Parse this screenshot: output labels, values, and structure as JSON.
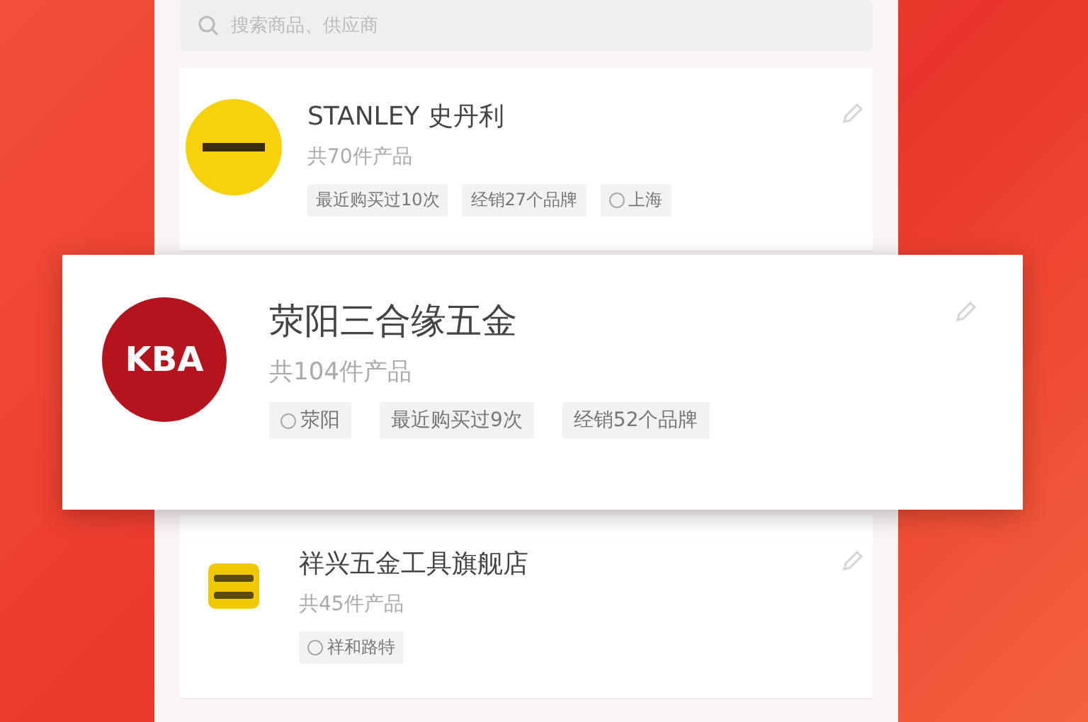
{
  "search": {
    "placeholder": "搜索商品、供应商"
  },
  "stores": [
    {
      "selected": false,
      "name": "STANLEY 史丹利",
      "count": "共70件产品",
      "logo": {
        "kind": "stanley"
      },
      "tags": [
        {
          "text": "最近购买过10次",
          "location": false
        },
        {
          "text": "经销27个品牌",
          "location": false
        },
        {
          "text": "上海",
          "location": true
        }
      ]
    },
    {
      "selected": true,
      "name": "荥阳三合缘五金",
      "count": "共104件产品",
      "logo": {
        "kind": "letters",
        "text": "KBA"
      },
      "tags": [
        {
          "text": "荥阳",
          "location": true
        },
        {
          "text": "最近购买过9次",
          "location": false
        },
        {
          "text": "经销52个品牌",
          "location": false
        }
      ]
    },
    {
      "selected": false,
      "name": "祥兴五金工具旗舰店",
      "count": "共45件产品",
      "logo": {
        "kind": "shop"
      },
      "tags": [
        {
          "text": "祥和路特",
          "location": true
        }
      ]
    }
  ]
}
